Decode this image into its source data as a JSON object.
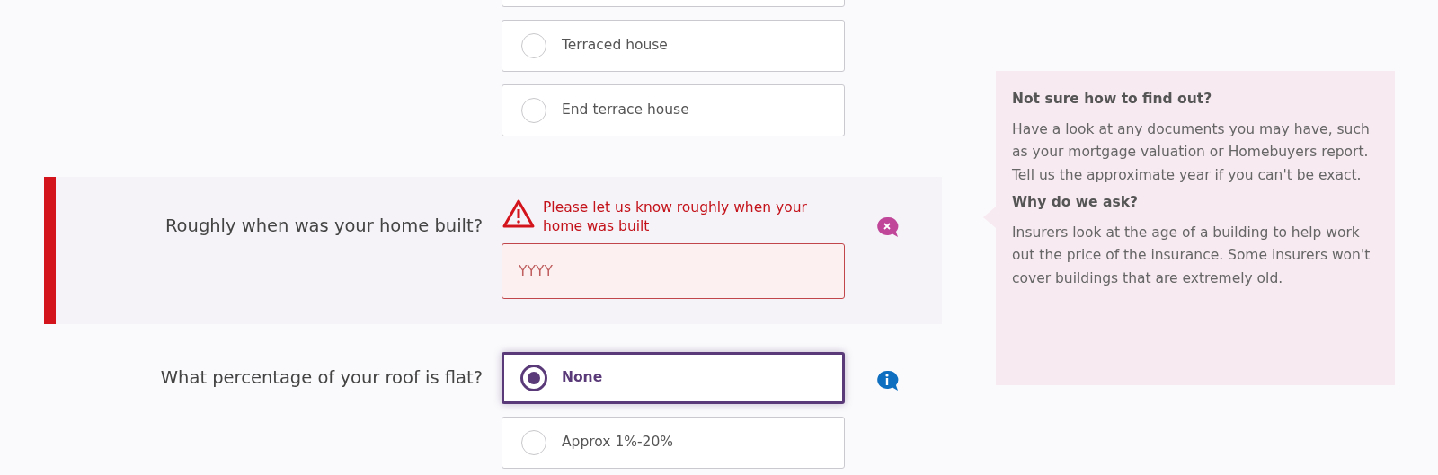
{
  "property_type": {
    "options": [
      {
        "label": "Terraced house",
        "selected": false
      },
      {
        "label": "End terrace house",
        "selected": false
      }
    ]
  },
  "build_year": {
    "label": "Roughly when was your home built?",
    "error": "Please let us know roughly when your home was built",
    "placeholder": "YYYY",
    "help_open": true
  },
  "flat_roof": {
    "label": "What percentage of your roof is flat?",
    "help_open": false,
    "options": [
      {
        "label": "None",
        "selected": true
      },
      {
        "label": "Approx 1%-20%",
        "selected": false
      }
    ]
  },
  "help_panel": {
    "sections": [
      {
        "heading": "Not sure how to find out?",
        "text": "Have a look at any documents you may have, such as your mortgage valuation or Homebuyers report. Tell us the approximate year if you can't be exact."
      },
      {
        "heading": "Why do we ask?",
        "text": "Insurers look at the age of a building to help work out the price of the insurance. Some insurers won't cover buildings that are extremely old."
      }
    ]
  }
}
